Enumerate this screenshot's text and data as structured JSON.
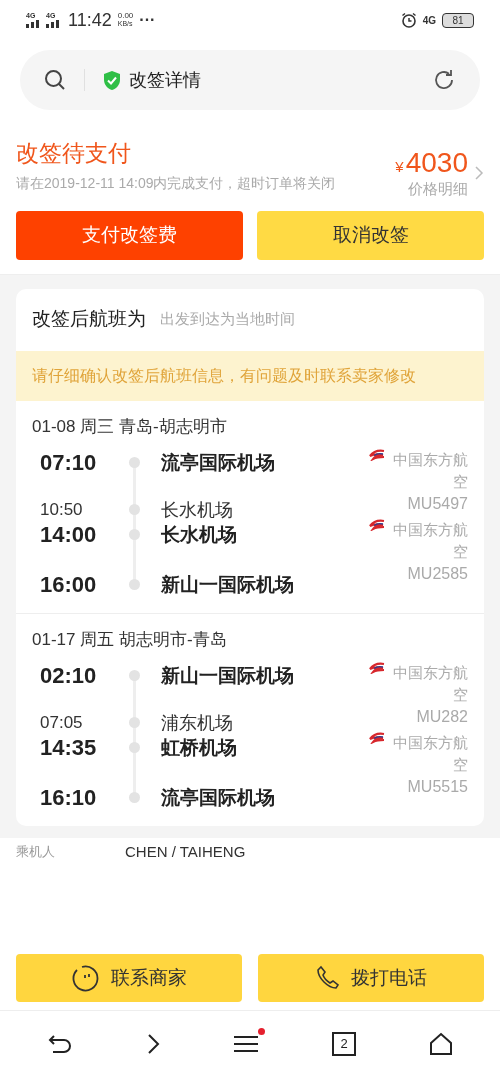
{
  "status_bar": {
    "sim1": "4G",
    "sim2": "4G",
    "time": "11:42",
    "speed": "0.00",
    "speed_unit": "KB/s",
    "dots": "···",
    "network": "4G",
    "battery": "81"
  },
  "address_bar": {
    "title": "改签详情"
  },
  "order": {
    "status": "改签待支付",
    "notice": "请在2019-12-11 14:09内完成支付，超时订单将关闭",
    "currency": "¥",
    "price": "4030",
    "price_link": "价格明细"
  },
  "actions": [
    {
      "label": "支付改签费",
      "kind": "primary"
    },
    {
      "label": "取消改签",
      "kind": "secondary"
    }
  ],
  "flight_card": {
    "title": "改签后航班为",
    "subtitle": "出发到达为当地时间",
    "warning": "请仔细确认改签后航班信息，有问题及时联系卖家修改",
    "legs": [
      {
        "header": "01-08 周三 青岛-胡志明市",
        "stops": [
          {
            "time": "07:10",
            "airport": "流亭国际机场",
            "kind": "major"
          },
          {
            "time": "10:50",
            "airport": "长水机场",
            "kind": "minor"
          },
          {
            "time": "14:00",
            "airport": "长水机场",
            "kind": "major"
          },
          {
            "time": "16:00",
            "airport": "新山一国际机场",
            "kind": "major"
          }
        ],
        "flights": [
          {
            "airline": "中国东方航空",
            "number": "MU5497"
          },
          {
            "airline": "中国东方航空",
            "number": "MU2585"
          }
        ]
      },
      {
        "header": "01-17 周五 胡志明市-青岛",
        "stops": [
          {
            "time": "02:10",
            "airport": "新山一国际机场",
            "kind": "major"
          },
          {
            "time": "07:05",
            "airport": "浦东机场",
            "kind": "minor"
          },
          {
            "time": "14:35",
            "airport": "虹桥机场",
            "kind": "major"
          },
          {
            "time": "16:10",
            "airport": "流亭国际机场",
            "kind": "major"
          }
        ],
        "flights": [
          {
            "airline": "中国东方航空",
            "number": "MU282"
          },
          {
            "airline": "中国东方航空",
            "number": "MU5515"
          }
        ]
      }
    ]
  },
  "passenger": {
    "label": "乘机人",
    "name": "CHEN / TAIHENG"
  },
  "bottom_buttons": [
    {
      "label": "联系商家",
      "kind": "chat"
    },
    {
      "label": "拨打电话",
      "kind": "phone"
    }
  ],
  "nav": {
    "tabs_count": "2",
    "menu_badge": true
  }
}
